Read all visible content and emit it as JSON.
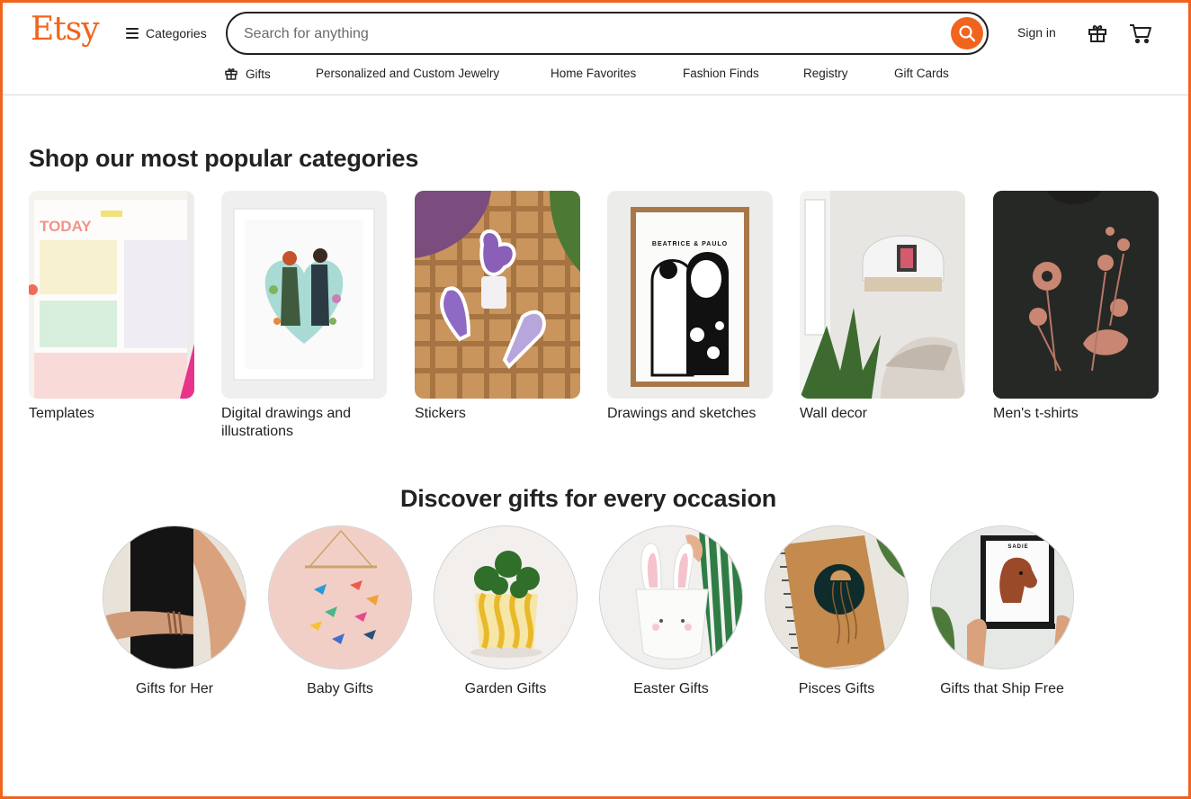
{
  "header": {
    "logo": "Etsy",
    "categories_label": "Categories",
    "search_placeholder": "Search for anything",
    "signin_label": "Sign in"
  },
  "subnav": [
    {
      "label": "Gifts",
      "icon": "gift-icon"
    },
    {
      "label": "Personalized and Custom Jewelry"
    },
    {
      "label": "Home Favorites"
    },
    {
      "label": "Fashion Finds"
    },
    {
      "label": "Registry"
    },
    {
      "label": "Gift Cards"
    }
  ],
  "popular": {
    "title": "Shop our most popular categories",
    "items": [
      {
        "label": "Templates"
      },
      {
        "label": "Digital drawings and illustrations"
      },
      {
        "label": "Stickers"
      },
      {
        "label": "Drawings and sketches"
      },
      {
        "label": "Wall decor"
      },
      {
        "label": "Men's t-shirts"
      }
    ],
    "image_text": {
      "templates_heading": "TODAY",
      "drawing_caption": "BEATRICE & PAULO"
    }
  },
  "occasions": {
    "title": "Discover gifts for every occasion",
    "items": [
      {
        "label": "Gifts for Her"
      },
      {
        "label": "Baby Gifts"
      },
      {
        "label": "Garden Gifts"
      },
      {
        "label": "Easter Gifts"
      },
      {
        "label": "Pisces Gifts"
      },
      {
        "label": "Gifts that Ship Free"
      }
    ],
    "image_text": {
      "portrait_name": "SADIE"
    }
  },
  "colors": {
    "brand": "#f1641e",
    "text": "#222222"
  }
}
